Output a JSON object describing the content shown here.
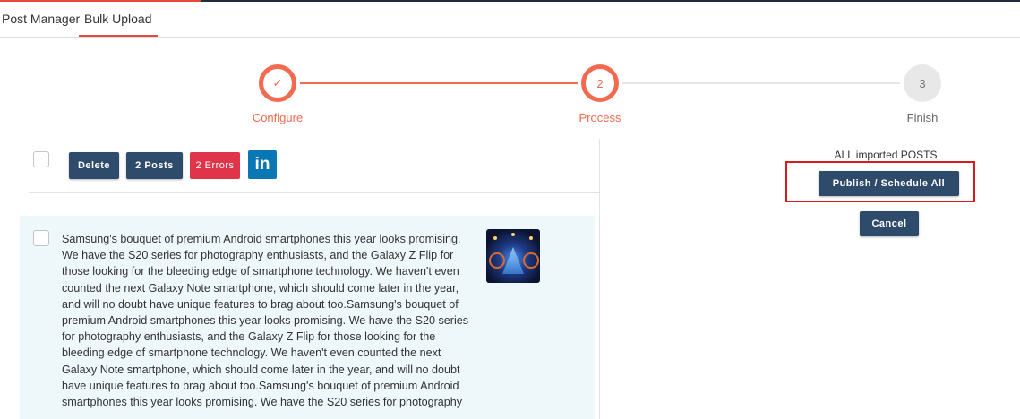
{
  "tabs": {
    "post_manager": "Post Manager",
    "bulk_upload": "Bulk Upload"
  },
  "stepper": {
    "steps": [
      {
        "marker": "✓",
        "label": "Configure",
        "state": "done"
      },
      {
        "marker": "2",
        "label": "Process",
        "state": "active"
      },
      {
        "marker": "3",
        "label": "Finish",
        "state": "pending"
      }
    ],
    "accent_color": "#f26a4f"
  },
  "toolbar": {
    "delete_label": "Delete",
    "posts_label": "2 Posts",
    "errors_label": "2 Errors",
    "linkedin_label": "in"
  },
  "post": {
    "text": "Samsung's bouquet of premium Android smartphones this year looks promising. We have the S20 series for photography enthusiasts, and the Galaxy Z Flip for those looking for the bleeding edge of smartphone technology. We haven't even counted the next Galaxy Note smartphone, which should come later in the year, and will no doubt have unique features to brag about too.Samsung's bouquet of premium Android smartphones this year looks promising. We have the S20 series for photography enthusiasts, and the Galaxy Z Flip for those looking for the bleeding edge of smartphone technology. We haven't even counted the next Galaxy Note smartphone, which should come later in the year, and will no doubt have unique features to brag about too.Samsung's bouquet of premium Android smartphones this year looks promising. We have the S20 series for photography"
  },
  "actions": {
    "imported_label": "ALL imported POSTS",
    "publish_label": "Publish / Schedule All",
    "cancel_label": "Cancel"
  },
  "colors": {
    "dark_button": "#2f4b6c",
    "error_button": "#e0344a",
    "linkedin": "#0a77b5",
    "highlight": "#d91a1a"
  }
}
